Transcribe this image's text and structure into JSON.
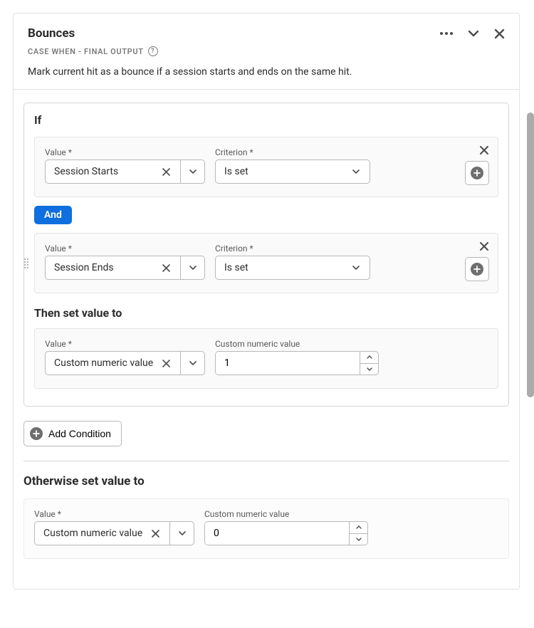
{
  "header": {
    "title": "Bounces",
    "subtitle": "CASE WHEN - FINAL OUTPUT",
    "description": "Mark current hit as a bounce if a session starts and ends on the same hit."
  },
  "labels": {
    "if_heading": "If",
    "value_label": "Value",
    "criterion_label": "Criterion",
    "custom_numeric_label": "Custom numeric value",
    "then_heading": "Then set value to",
    "otherwise_heading": "Otherwise set value to",
    "add_condition": "Add Condition",
    "and": "And"
  },
  "if_block": {
    "cond1": {
      "value": "Session Starts",
      "criterion": "Is set"
    },
    "cond2": {
      "value": "Session Ends",
      "criterion": "Is set"
    },
    "then": {
      "value": "Custom numeric value",
      "numeric": "1"
    }
  },
  "otherwise": {
    "value": "Custom numeric value",
    "numeric": "0"
  }
}
